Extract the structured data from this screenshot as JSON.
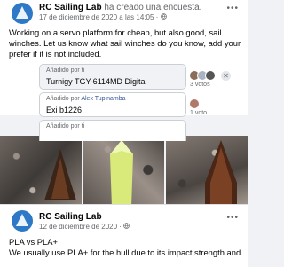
{
  "post1": {
    "author": "RC Sailing Lab",
    "action": "ha creado una encuesta.",
    "date": "17 de diciembre de 2020 a las 14:05",
    "separator": "·",
    "body": "Working on a servo platform for cheap, but also good, sail winches. Let us know what sail winches do you know, add your prefer if it is not included.",
    "options": [
      {
        "added_by": "Añadido por ti",
        "label": "Turnigy TGY-6114MD Digital",
        "votes": "3 votos"
      },
      {
        "added_by_prefix": "Añadido por",
        "added_by_name": "Alex Tupinamba",
        "label": "Exi b1226",
        "votes": "1 voto"
      },
      {
        "added_by": "Añadido por ti",
        "label": ""
      }
    ]
  },
  "post2": {
    "author": "RC Sailing Lab",
    "date": "12 de diciembre de 2020",
    "separator": "·",
    "title": "PLA vs PLA+",
    "body": "We usually use PLA+ for the hull due to its impact strength and"
  },
  "icons": {
    "more": "more-horizontal-icon",
    "remove": "close-icon",
    "audience": "globe-icon"
  },
  "colors": {
    "link": "#385898",
    "brand": "#2d79c7",
    "secondary_text": "#65676b"
  }
}
